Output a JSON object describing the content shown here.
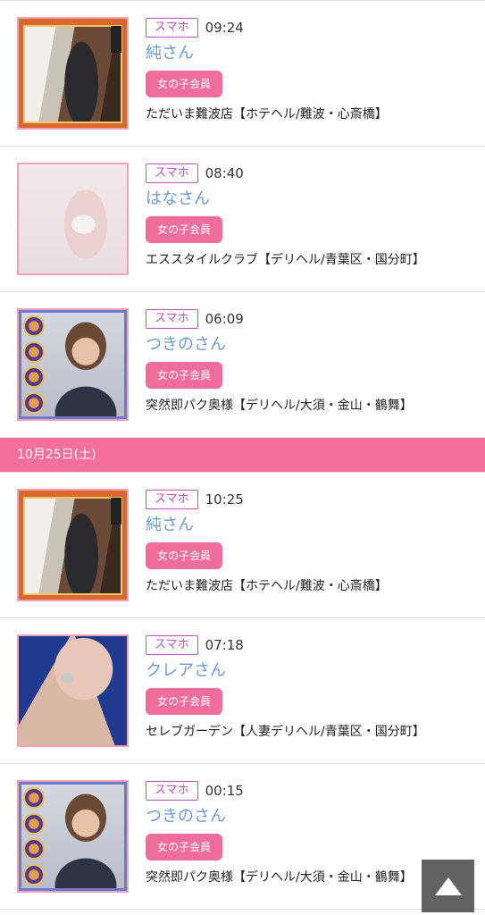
{
  "date_header": "10月25日(土)",
  "group1": [
    {
      "device": "スマホ",
      "time": "09:24",
      "name": "純さん",
      "member": "女の子会員",
      "shop": "ただいま難波店【ホテヘル/難波・心斎橋】"
    },
    {
      "device": "スマホ",
      "time": "08:40",
      "name": "はなさん",
      "member": "女の子会員",
      "shop": "エススタイルクラブ【デリヘル/青葉区・国分町】"
    },
    {
      "device": "スマホ",
      "time": "06:09",
      "name": "つきのさん",
      "member": "女の子会員",
      "shop": "突然即パク奥様【デリヘル/大須・金山・鶴舞】"
    }
  ],
  "group2": [
    {
      "device": "スマホ",
      "time": "10:25",
      "name": "純さん",
      "member": "女の子会員",
      "shop": "ただいま難波店【ホテヘル/難波・心斎橋】"
    },
    {
      "device": "スマホ",
      "time": "07:18",
      "name": "クレアさん",
      "member": "女の子会員",
      "shop": "セレブガーデン【人妻デリヘル/青葉区・国分町】"
    },
    {
      "device": "スマホ",
      "time": "00:15",
      "name": "つきのさん",
      "member": "女の子会員",
      "shop": "突然即パク奥様【デリヘル/大須・金山・鶴舞】"
    }
  ],
  "colors": {
    "accent_pink": "#ef6d9a",
    "date_bar": "#f36f9c",
    "name_link": "#6c9bd2",
    "device_badge": "#c24fc6"
  },
  "icons": {
    "scroll_top": "triangle-up-icon"
  }
}
